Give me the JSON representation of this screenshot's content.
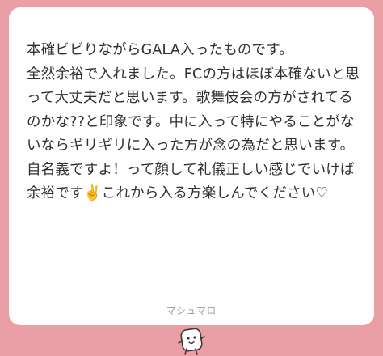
{
  "message": {
    "text": "本確ビビりながらGALA入ったものです。\n全然余裕で入れました。FCの方はほぼ本確ないと思って大丈夫だと思います。歌舞伎会の方がされてるのかな??と印象です。中に入って特にやることがないならギリギリに入った方が念の為だと思います。\n自名義ですよ！って顔して礼儀正しい感じでいけば余裕です✌️これから入る方楽しんでください♡"
  },
  "footer": {
    "brand": "マシュマロ",
    "mascot_icon": "marshmallow-mascot-icon"
  },
  "colors": {
    "background": "#ea9ea6",
    "card": "#ffffff",
    "text": "#2f2f2f",
    "brand": "#9b9b9b"
  }
}
